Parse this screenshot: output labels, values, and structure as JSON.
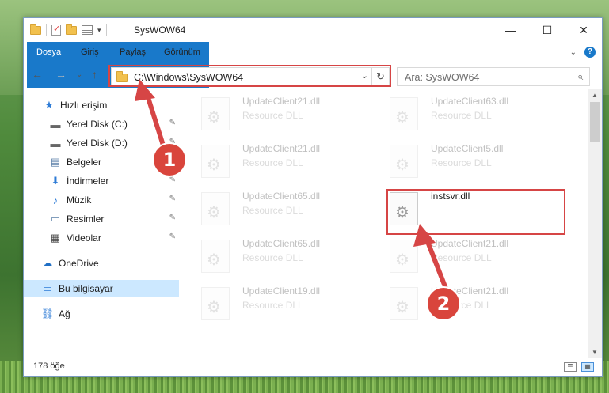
{
  "window": {
    "title": "SysWOW64",
    "minimize": "—",
    "maximize": "☐",
    "close": "✕"
  },
  "ribbon": {
    "tabs": [
      "Dosya",
      "Giriş",
      "Paylaş",
      "Görünüm"
    ],
    "expand": "⌄",
    "help": "?"
  },
  "nav": {
    "back": "←",
    "forward": "→",
    "recent": "⌄",
    "up": "↑",
    "address": "C:\\Windows\\SysWOW64",
    "address_drop": "⌄",
    "refresh": "↻",
    "search_placeholder": "Ara: SysWOW64",
    "search_icon": "⌕"
  },
  "sidebar": {
    "items": [
      {
        "label": "Hızlı erişim",
        "icon": "star-icon",
        "glyph": "★",
        "pinned": false
      },
      {
        "label": "Yerel Disk (C:)",
        "icon": "drive-icon",
        "glyph": "▬",
        "pinned": true
      },
      {
        "label": "Yerel Disk (D:)",
        "icon": "drive-icon",
        "glyph": "▬",
        "pinned": true
      },
      {
        "label": "Belgeler",
        "icon": "document-icon",
        "glyph": "▤",
        "pinned": true
      },
      {
        "label": "İndirmeler",
        "icon": "download-icon",
        "glyph": "⬇",
        "pinned": true
      },
      {
        "label": "Müzik",
        "icon": "music-icon",
        "glyph": "♪",
        "pinned": true
      },
      {
        "label": "Resimler",
        "icon": "pictures-icon",
        "glyph": "▭",
        "pinned": true
      },
      {
        "label": "Videolar",
        "icon": "video-icon",
        "glyph": "▦",
        "pinned": true
      },
      {
        "label": "OneDrive",
        "icon": "cloud-icon",
        "glyph": "☁",
        "pinned": false
      },
      {
        "label": "Bu bilgisayar",
        "icon": "computer-icon",
        "glyph": "▭",
        "pinned": false
      },
      {
        "label": "Ağ",
        "icon": "network-icon",
        "glyph": "⛓",
        "pinned": false
      }
    ],
    "pin_glyph": "📌"
  },
  "files": [
    {
      "name": "UpdateClient21.dll",
      "desc": "Resource DLL",
      "faded": true
    },
    {
      "name": "UpdateClient63.dll",
      "desc": "Resource DLL",
      "faded": true
    },
    {
      "name": "UpdateClient21.dll",
      "desc": "Resource DLL",
      "faded": true
    },
    {
      "name": "UpdateClient5.dll",
      "desc": "Resource DLL",
      "faded": true
    },
    {
      "name": "UpdateClient65.dll",
      "desc": "Resource DLL",
      "faded": true
    },
    {
      "name": "instsvr.dll",
      "desc": "",
      "faded": false
    },
    {
      "name": "UpdateClient65.dll",
      "desc": "Resource DLL",
      "faded": true
    },
    {
      "name": "UpdateClient21.dll",
      "desc": "Resource DLL",
      "faded": true
    },
    {
      "name": "UpdateClient19.dll",
      "desc": "Resource DLL",
      "faded": true
    },
    {
      "name": "UpdateClient21.dll",
      "desc": "Resource DLL",
      "faded": true
    }
  ],
  "status": {
    "count": "178 öğe"
  },
  "annotations": {
    "step1": "1",
    "step2": "2",
    "color": "#d64545"
  }
}
